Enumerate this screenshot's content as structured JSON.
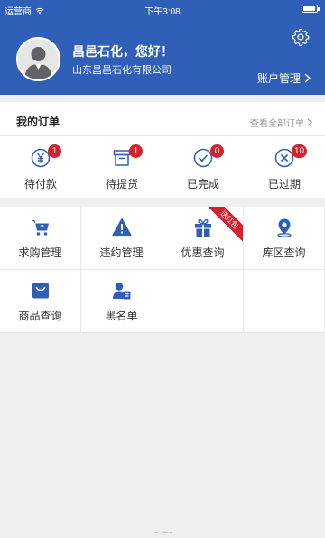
{
  "status_bar": {
    "carrier": "运营商",
    "time": "下午3:08",
    "battery_level": 0.9
  },
  "header": {
    "greeting": "昌邑石化，您好！",
    "company": "山东昌邑石化有限公司",
    "account_link": "账户管理",
    "colors": {
      "background": "#2f5fb7"
    }
  },
  "orders": {
    "title": "我的订单",
    "view_all": "查看全部订单",
    "items": [
      {
        "label": "待付款",
        "badge": "1",
        "icon": "yen-circle-icon"
      },
      {
        "label": "待提货",
        "badge": "1",
        "icon": "box-icon"
      },
      {
        "label": "已完成",
        "badge": "0",
        "icon": "check-circle-icon"
      },
      {
        "label": "已过期",
        "badge": "10",
        "icon": "x-circle-icon"
      }
    ]
  },
  "grid": {
    "items": [
      {
        "label": "求购管理",
        "icon": "cart-question-icon"
      },
      {
        "label": "违约管理",
        "icon": "warning-icon"
      },
      {
        "label": "优惠查询",
        "icon": "gift-icon",
        "ribbon": "送红包"
      },
      {
        "label": "库区查询",
        "icon": "location-pin-icon"
      },
      {
        "label": "商品查询",
        "icon": "shopping-bag-icon"
      },
      {
        "label": "黑名单",
        "icon": "user-list-icon"
      }
    ]
  },
  "colors": {
    "accent": "#2f5fb7",
    "badge": "#d5202e"
  }
}
